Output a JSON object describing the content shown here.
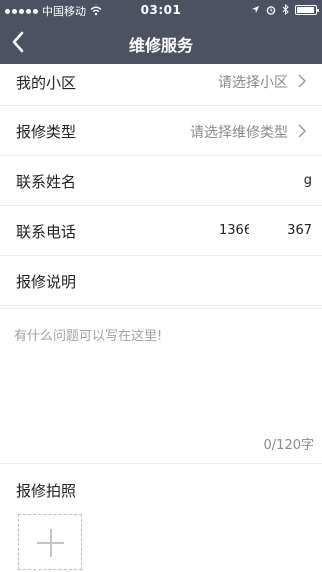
{
  "status_bar": {
    "carrier": "中国移动",
    "time": "03:01",
    "icons": [
      "signal-dots-icon",
      "wifi-icon",
      "location-icon",
      "alarm-icon",
      "bluetooth-icon",
      "battery-icon"
    ],
    "battery_level": 0.95
  },
  "nav": {
    "title": "维修服务",
    "back_icon": "chevron-left-icon"
  },
  "form": {
    "community": {
      "label": "我的小区",
      "value": "请选择小区"
    },
    "repair_type": {
      "label": "报修类型",
      "value": "请选择维修类型"
    },
    "contact_name": {
      "label": "联系姓名",
      "value": "g"
    },
    "contact_phone": {
      "label": "联系电话",
      "value_part1": "1366",
      "value_part2": "367"
    },
    "description": {
      "label": "报修说明",
      "placeholder": "有什么问题可以写在这里!",
      "counter": "0/120字"
    },
    "photos": {
      "label": "报修拍照",
      "add_icon": "plus-icon"
    }
  },
  "colors": {
    "nav_bg": "#4c5262",
    "divider": "#ececec",
    "placeholder": "#a3a3a3"
  }
}
